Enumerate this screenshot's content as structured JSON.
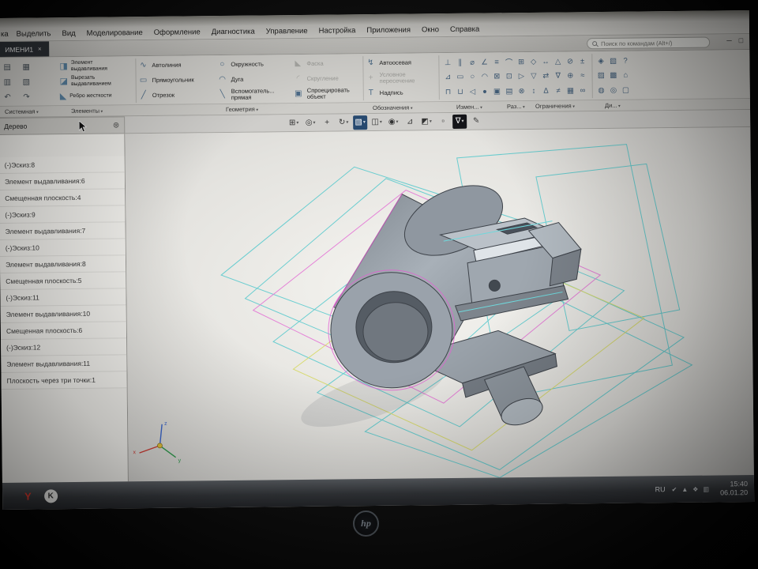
{
  "window": {
    "menu_partial": "ка",
    "menu": [
      "Выделить",
      "Вид",
      "Моделирование",
      "Оформление",
      "Диагностика",
      "Управление",
      "Настройка",
      "Приложения",
      "Окно",
      "Справка"
    ],
    "tab_title": "ИМЕНИ1",
    "tab_close": "×",
    "search_placeholder": "Поиск по командам (Alt+/)",
    "controls": [
      "─",
      "□"
    ]
  },
  "toolbar": {
    "file_icons": [
      "▤",
      "▦",
      "▥",
      "▧",
      "↶",
      "↷"
    ],
    "feature_buttons": [
      {
        "icon": "◨",
        "label": "Элемент выдавливания"
      },
      {
        "icon": "◪",
        "label": "Вырезать выдавливанием"
      },
      {
        "icon": "◣",
        "label": "Ребро жесткости"
      }
    ],
    "geometry_col1": [
      {
        "icon": "∿",
        "label": "Автолиния"
      },
      {
        "icon": "▭",
        "label": "Прямоугольник"
      },
      {
        "icon": "╱",
        "label": "Отрезок"
      }
    ],
    "geometry_col2": [
      {
        "icon": "○",
        "label": "Окружность"
      },
      {
        "icon": "◠",
        "label": "Дуга"
      },
      {
        "icon": "╲",
        "label": "Вспомогатель... прямая"
      }
    ],
    "geometry_col3": [
      {
        "icon": "◣",
        "label": "Фаска",
        "disabled": true
      },
      {
        "icon": "◜",
        "label": "Скругление",
        "disabled": true
      },
      {
        "icon": "▣",
        "label": "Спроецировать объект"
      }
    ],
    "notation_col": [
      {
        "icon": "↯",
        "label": "Автоосевая"
      },
      {
        "icon": "+",
        "label": "Условное пересечение",
        "disabled": true
      },
      {
        "icon": "T",
        "label": "Надпись"
      }
    ],
    "group_labels": [
      "Системная",
      "Элементы",
      "Геометрия",
      "Обозначения",
      "Измен...",
      "Раз...",
      "Ограничения",
      "Ди..."
    ],
    "grid": {
      "r1": [
        "⊥",
        "∥",
        "⌀",
        "∠",
        "≡",
        "⌒",
        "⊞",
        "◇",
        "↔",
        "△",
        "⊘",
        "±"
      ],
      "r2": [
        "⊿",
        "▭",
        "○",
        "◠",
        "⊠",
        "⊡",
        "▷",
        "▽",
        "⇄",
        "∇",
        "⊕",
        "≈"
      ],
      "r3": [
        "⊓",
        "⊔",
        "◁",
        "●",
        "▣",
        "▤",
        "⊗",
        "↕",
        "∆",
        "≠",
        "▦",
        "∞"
      ]
    },
    "far": {
      "r1": [
        "◈",
        "▧",
        "?"
      ],
      "r2": [
        "▨",
        "▩",
        "⌂"
      ],
      "r3": [
        "◍",
        "◎",
        "▢"
      ]
    }
  },
  "viewbar": {
    "icons": [
      {
        "glyph": "⊞",
        "dd": true
      },
      {
        "glyph": "◎",
        "dd": true
      },
      {
        "glyph": "+"
      },
      {
        "glyph": "↻",
        "dd": true
      },
      {
        "glyph": "▧",
        "dd": true,
        "blue": true
      },
      {
        "glyph": "◫",
        "dd": true
      },
      {
        "glyph": "◉",
        "dd": true
      },
      {
        "glyph": "⊿"
      },
      {
        "glyph": "◩",
        "dd": true
      },
      {
        "glyph": "▫"
      },
      {
        "glyph": "∇",
        "dd": true,
        "active": true
      },
      {
        "glyph": "✎"
      }
    ]
  },
  "tree": {
    "title": "Дерево",
    "gear": "⊛",
    "items": [
      "(-)Эскиз:8",
      "Элемент выдавливания:6",
      "Смещенная плоскость:4",
      "(-)Эскиз:9",
      "Элемент выдавливания:7",
      "(-)Эскиз:10",
      "Элемент выдавливания:8",
      "Смещенная плоскость:5",
      "(-)Эскиз:11",
      "Элемент выдавливания:10",
      "Смещенная плоскость:6",
      "(-)Эскиз:12",
      "Элемент выдавливания:11",
      "Плоскость через три точки:1"
    ]
  },
  "viewport": {
    "axis_labels": {
      "x": "x",
      "y": "y",
      "z": "z"
    }
  },
  "taskbar": {
    "left_items": [
      {
        "glyph": "Y",
        "red": true
      },
      {
        "glyph": "K",
        "circle": true
      }
    ],
    "lang": "RU",
    "tray_icons": [
      "✔",
      "▲",
      "❖",
      "▥"
    ],
    "time": "15:40",
    "date": "06.01.20"
  },
  "laptop": {
    "brand": "hp"
  }
}
